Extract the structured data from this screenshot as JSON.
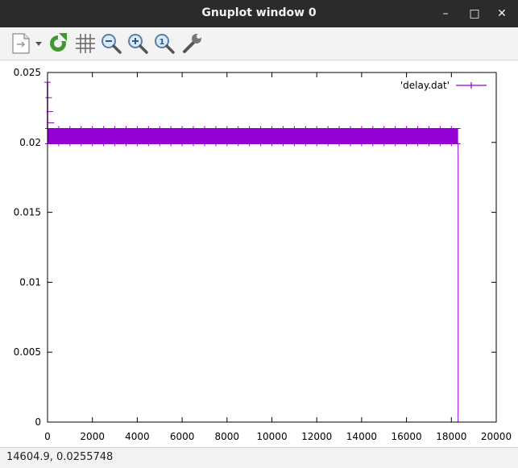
{
  "window": {
    "title": "Gnuplot window 0",
    "controls": {
      "minimize": "–",
      "maximize": "□",
      "close": "✕"
    }
  },
  "toolbar": {
    "items": [
      {
        "name": "export",
        "icon": "export-document-icon"
      },
      {
        "name": "replot",
        "icon": "refresh-icon"
      },
      {
        "name": "grid",
        "icon": "grid-icon"
      },
      {
        "name": "zoom-previous",
        "icon": "zoom-out-icon"
      },
      {
        "name": "zoom-next",
        "icon": "zoom-in-icon"
      },
      {
        "name": "autoscale",
        "icon": "zoom-fit-icon"
      },
      {
        "name": "settings",
        "icon": "wrench-icon"
      }
    ]
  },
  "statusbar": {
    "text": "14604.9,  0.0255748"
  },
  "chart_data": {
    "type": "line",
    "title": "",
    "xlabel": "",
    "ylabel": "",
    "xlim": [
      0,
      20000
    ],
    "ylim": [
      0,
      0.025
    ],
    "xticks": [
      "0",
      "2000",
      "4000",
      "6000",
      "8000",
      "10000",
      "12000",
      "14000",
      "16000",
      "18000",
      "20000"
    ],
    "yticks": [
      "0",
      "0.005",
      "0.01",
      "0.015",
      "0.02",
      "0.025"
    ],
    "grid": false,
    "legend": "top-right",
    "series": [
      {
        "name": "'delay.dat'",
        "color": "#9400d3",
        "marker": "+",
        "initial_spike": {
          "x": [
            0,
            50,
            100,
            150
          ],
          "y": [
            0.0243,
            0.0232,
            0.0222,
            0.0214
          ]
        },
        "band": {
          "x_start": 0,
          "x_end": 18300,
          "y_low": 0.0199,
          "y_high": 0.021
        },
        "drop": {
          "x": 18300,
          "y_from": 0.0199,
          "y_to": 0
        }
      }
    ]
  }
}
